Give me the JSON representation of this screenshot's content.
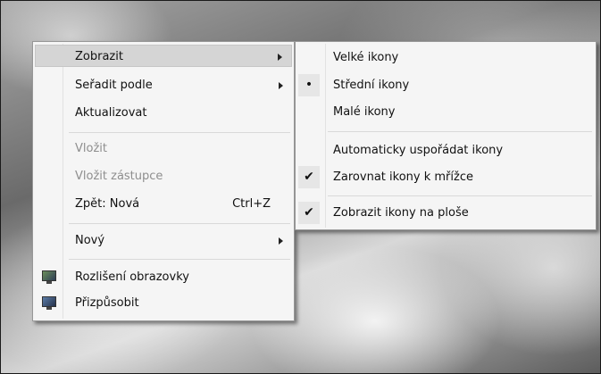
{
  "context_menu": {
    "items": [
      {
        "label": "Zobrazit"
      },
      {
        "label": "Seřadit podle"
      },
      {
        "label": "Aktualizovat"
      },
      {
        "label": "Vložit"
      },
      {
        "label": "Vložit zástupce"
      },
      {
        "label": "Zpět: Nová",
        "shortcut": "Ctrl+Z"
      },
      {
        "label": "Nový"
      },
      {
        "label": "Rozlišení obrazovky",
        "icon": "display-settings-icon"
      },
      {
        "label": "Přizpůsobit",
        "icon": "personalize-icon"
      }
    ]
  },
  "submenu": {
    "items": [
      {
        "label": "Velké ikony"
      },
      {
        "label": "Střední ikony",
        "mark": "•"
      },
      {
        "label": "Malé ikony"
      },
      {
        "label": "Automaticky uspořádat ikony"
      },
      {
        "label": "Zarovnat ikony k mřížce",
        "mark": "✔"
      },
      {
        "label": "Zobrazit ikony na ploše",
        "mark": "✔"
      }
    ]
  }
}
